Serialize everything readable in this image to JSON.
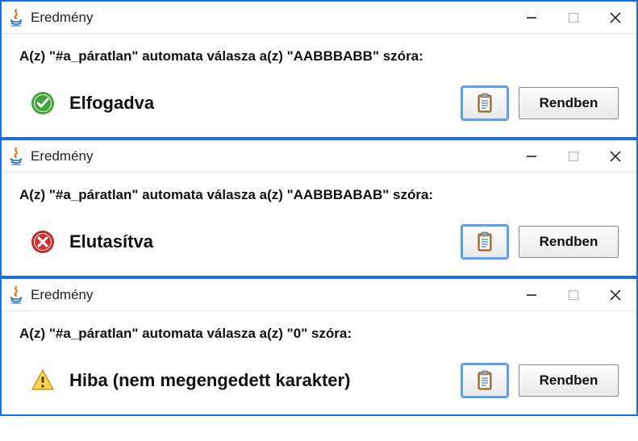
{
  "dialogs": [
    {
      "title": "Eredmény",
      "prompt": "A(z) \"#a_páratlan\" automata válasza a(z) \"AABBBABB\" szóra:",
      "status_kind": "accept",
      "status_text": "Elfogadva",
      "ok_label": "Rendben"
    },
    {
      "title": "Eredmény",
      "prompt": "A(z) \"#a_páratlan\" automata válasza a(z) \"AABBBABAB\" szóra:",
      "status_kind": "reject",
      "status_text": "Elutasítva",
      "ok_label": "Rendben"
    },
    {
      "title": "Eredmény",
      "prompt": "A(z) \"#a_páratlan\" automata válasza a(z) \"0\" szóra:",
      "status_kind": "warn",
      "status_text": "Hiba (nem megengedett karakter)",
      "ok_label": "Rendben"
    }
  ]
}
